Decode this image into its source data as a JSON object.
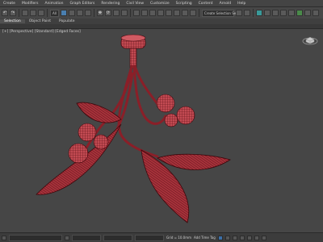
{
  "menu": [
    "Create",
    "Modifiers",
    "Animation",
    "Graph Editors",
    "Rendering",
    "Civil View",
    "Customize",
    "Scripting",
    "Content",
    "Arnold",
    "Help"
  ],
  "toolbar": {
    "selection_filter": "All",
    "named_selection_placeholder": "Create Selection Set"
  },
  "ribbon_tabs": [
    "Selection",
    "Object Paint",
    "Populate"
  ],
  "viewport": {
    "label": "[+] [Perspective] [Standard] [Edged Faces]"
  },
  "statusbar": {
    "coord_x": "",
    "grid_text": "Grid = 10.0mm",
    "addtime_text": "Add Time Tag"
  },
  "colors": {
    "mesh_fill": "#c24a52",
    "mesh_wire": "#5a0e14",
    "viewport_bg": "#464646"
  }
}
